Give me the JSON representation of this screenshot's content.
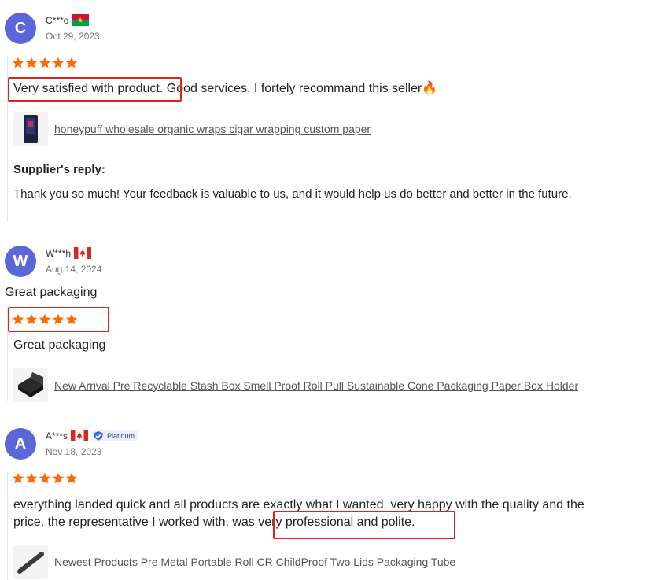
{
  "reviews": [
    {
      "avatar_letter": "C",
      "name": "C***o",
      "country_flag": "burkina-faso-flag",
      "date": "Oct 29, 2023",
      "rating": 5,
      "text_highlight": "Very satisfied with product.",
      "text_rest": "Good services. I fortely recommand this seller",
      "emoji": "🔥",
      "product_link": "honeypuff wholesale organic wraps cigar wrapping custom paper",
      "reply_title": "Supplier's reply:",
      "reply_text": "Thank you so much! Your feedback is valuable to us, and it would help us do better and better in the future."
    },
    {
      "avatar_letter": "W",
      "name": "W***h",
      "country_flag": "canada-flag",
      "date": "Aug 14, 2024",
      "headline": "Great packaging",
      "rating": 5,
      "text": "Great packaging",
      "product_link": "New Arrival Pre Recyclable Stash Box Smell Proof Roll Pull Sustainable Cone Packaging Paper Box Holder"
    },
    {
      "avatar_letter": "A",
      "name": "A***s",
      "country_flag": "canada-flag",
      "badge": "Platinum",
      "date": "Nov 18, 2023",
      "rating": 5,
      "text_line1": "everything landed quick and all products are exactly what I wanted. very happy with the quality and the",
      "text_line2_start": "price, the representative I worked with, was ",
      "text_line2_highlight": "very professional and polite.",
      "product_link": "Newest Products Pre Metal Portable Roll CR ChildProof Two Lids Packaging Tube"
    }
  ],
  "colors": {
    "avatar": "#5b67d8",
    "star": "#ff6a00",
    "highlight": "#e0201b",
    "link": "#555555"
  }
}
